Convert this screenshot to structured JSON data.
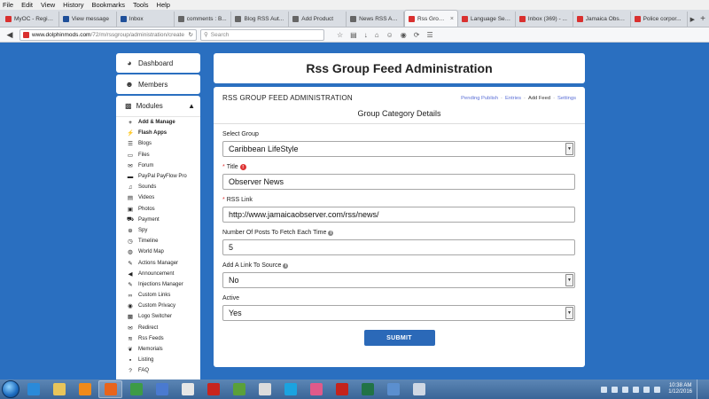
{
  "menu": [
    "File",
    "Edit",
    "View",
    "History",
    "Bookmarks",
    "Tools",
    "Help"
  ],
  "tabs": [
    {
      "label": "MyOC - Regist...",
      "color": "#d9302f",
      "active": false
    },
    {
      "label": "View message",
      "color": "#1f4f99",
      "active": false
    },
    {
      "label": "Inbox",
      "color": "#1f4f99",
      "active": false
    },
    {
      "label": "comments : B...",
      "color": "#666666",
      "active": false
    },
    {
      "label": "Blog RSS Aut...",
      "color": "#666666",
      "active": false
    },
    {
      "label": "Add Product",
      "color": "#666666",
      "active": false
    },
    {
      "label": "News RSS Aut...",
      "color": "#666666",
      "active": false
    },
    {
      "label": "Rss Group...",
      "color": "#d9302f",
      "active": true
    },
    {
      "label": "Language Set...",
      "color": "#d9302f",
      "active": false
    },
    {
      "label": "Inbox (369) - ...",
      "color": "#d9302f",
      "active": false
    },
    {
      "label": "Jamaica Obse...",
      "color": "#d9302f",
      "active": false
    },
    {
      "label": "Police corpor...",
      "color": "#d9302f",
      "active": false
    }
  ],
  "nav": {
    "url_host": "www.dolphinmods.com",
    "url_path": "/72/m/rssgroup/administration/create",
    "search_placeholder": "Search"
  },
  "sidebar": {
    "dashboard": "Dashboard",
    "members": "Members",
    "modules": "Modules",
    "items": [
      {
        "label": "Add & Manage",
        "bold": true,
        "icon": "plus-icon"
      },
      {
        "label": "Flash Apps",
        "bold": true,
        "icon": "bolt-icon"
      },
      {
        "label": "Blogs",
        "bold": false,
        "icon": "list-icon"
      },
      {
        "label": "Files",
        "bold": false,
        "icon": "folder-icon"
      },
      {
        "label": "Forum",
        "bold": false,
        "icon": "comments-icon"
      },
      {
        "label": "PayPal PayFlow Pro",
        "bold": false,
        "icon": "card-icon"
      },
      {
        "label": "Sounds",
        "bold": false,
        "icon": "music-icon"
      },
      {
        "label": "Videos",
        "bold": false,
        "icon": "film-icon"
      },
      {
        "label": "Photos",
        "bold": false,
        "icon": "picture-icon"
      },
      {
        "label": "Payment",
        "bold": false,
        "icon": "cart-icon"
      },
      {
        "label": "Spy",
        "bold": false,
        "icon": "crosshair-icon"
      },
      {
        "label": "Timeline",
        "bold": false,
        "icon": "clock-icon"
      },
      {
        "label": "World Map",
        "bold": false,
        "icon": "globe-icon"
      },
      {
        "label": "Actions Manager",
        "bold": false,
        "icon": "wrench-icon"
      },
      {
        "label": "Announcement",
        "bold": false,
        "icon": "bullhorn-icon"
      },
      {
        "label": "Injections Manager",
        "bold": false,
        "icon": "wrench-icon"
      },
      {
        "label": "Custom Links",
        "bold": false,
        "icon": "link-icon"
      },
      {
        "label": "Custom Privacy",
        "bold": false,
        "icon": "eye-icon"
      },
      {
        "label": "Logo Switcher",
        "bold": false,
        "icon": "image-icon"
      },
      {
        "label": "Redirect",
        "bold": false,
        "icon": "envelope-icon"
      },
      {
        "label": "Rss Feeds",
        "bold": false,
        "icon": "feed-icon"
      },
      {
        "label": "Memorials",
        "bold": false,
        "icon": "leaf-icon"
      },
      {
        "label": "Listing",
        "bold": false,
        "icon": "briefcase-icon"
      },
      {
        "label": "FAQ",
        "bold": false,
        "icon": "question-icon"
      }
    ]
  },
  "main": {
    "title": "Rss Group Feed Administration",
    "heading": "RSS GROUP FEED ADMINISTRATION",
    "links": {
      "pending": "Pending Publish",
      "entries": "Entries",
      "add_feed": "Add Feed",
      "settings": "Settings"
    },
    "subheading": "Group Category Details",
    "fields": {
      "group": {
        "label": "Select Group",
        "value": "Caribbean LifeStyle"
      },
      "title": {
        "label": "Title",
        "value": "Observer News"
      },
      "rss": {
        "label": "RSS Link",
        "value": "http://www.jamaicaobserver.com/rss/news/"
      },
      "posts": {
        "label": "Number Of Posts To Fetch Each Time",
        "value": "5"
      },
      "link": {
        "label": "Add A Link To Source",
        "value": "No"
      },
      "active": {
        "label": "Active",
        "value": "Yes"
      }
    },
    "submit": "SUBMIT"
  },
  "taskbar": {
    "time": "10:38 AM",
    "date": "1/12/2016",
    "apps": [
      {
        "name": "ie-icon",
        "color": "#2a8ad9"
      },
      {
        "name": "explorer-icon",
        "color": "#e9c55a"
      },
      {
        "name": "media-player-icon",
        "color": "#f08a1a"
      },
      {
        "name": "firefox-icon",
        "color": "#e8641b"
      },
      {
        "name": "chrome-icon",
        "color": "#3d9b47"
      },
      {
        "name": "user-icon",
        "color": "#4a7ad0"
      },
      {
        "name": "notepad-icon",
        "color": "#e6e6e6"
      },
      {
        "name": "filezilla-icon",
        "color": "#c8251e"
      },
      {
        "name": "frog-icon",
        "color": "#5aa03a"
      },
      {
        "name": "font-icon",
        "color": "#dcdcdc"
      },
      {
        "name": "skype-icon",
        "color": "#1ba3e0"
      },
      {
        "name": "eraser-icon",
        "color": "#e05a8a"
      },
      {
        "name": "acrobat-icon",
        "color": "#c4231c"
      },
      {
        "name": "excel-icon",
        "color": "#217346"
      },
      {
        "name": "image-viewer-icon",
        "color": "#5b8fcf"
      },
      {
        "name": "tools-icon",
        "color": "#cfd8e4"
      }
    ]
  }
}
